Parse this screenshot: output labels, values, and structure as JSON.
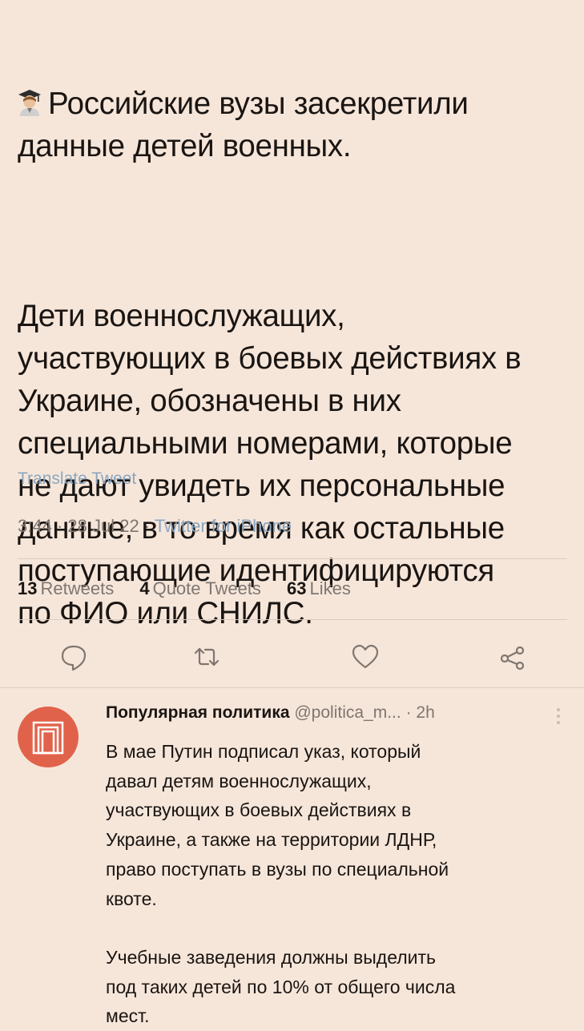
{
  "tweet": {
    "title_line": "Российские вузы засекретили\nданные детей военных.",
    "body": "Дети военнослужащих,\nучаствующих в боевых действиях в\nУкраине, обозначены в них\nспециальными номерами, которые\nне дают увидеть их персональные\nданные, в то время как остальные\nпоступающие идентифицируются\nпо ФИО или СНИЛС.",
    "emoji_icon": "student-emoji-icon",
    "translate_label": "Translate Tweet",
    "time": "3:44",
    "date": "28 Jul 22",
    "source": "Twitter for iPhone"
  },
  "stats": {
    "retweets_count": "13",
    "retweets_label": "Retweets",
    "quotes_count": "4",
    "quotes_label": "Quote Tweets",
    "likes_count": "63",
    "likes_label": "Likes"
  },
  "actions": {
    "reply_icon": "reply-icon",
    "retweet_icon": "retweet-icon",
    "like_icon": "heart-icon",
    "share_icon": "share-icon"
  },
  "reply": {
    "name": "Популярная политика",
    "handle": "@politica_m...",
    "time": "· 2h",
    "text": "В мае Путин подписал указ, который\nдавал детям военнослужащих,\nучаствующих в боевых действиях в\nУкраине, а также на территории ЛДНР,\nправо поступать в вузы по специальной\nквоте.\n\nУчебные заведения должны выделить\nпод таких детей по 10% от общего числа\nмест."
  },
  "colors": {
    "background": "#f6e6da",
    "link": "#8ba6bf",
    "avatar": "#e1624a"
  }
}
